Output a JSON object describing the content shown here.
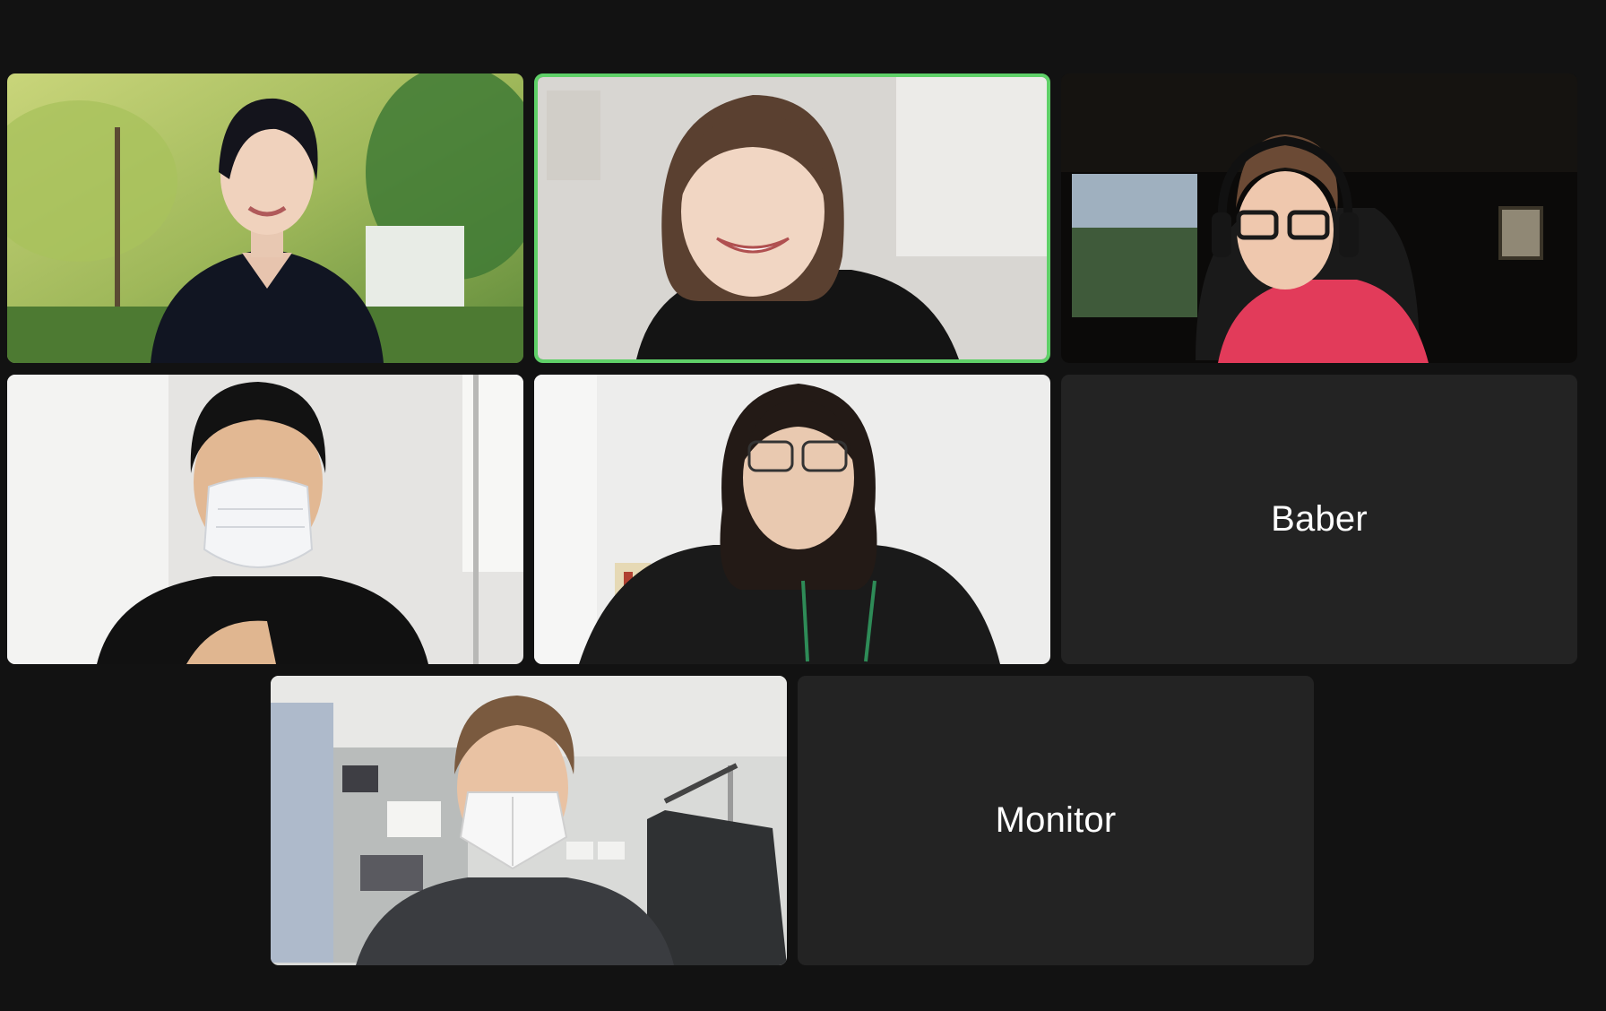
{
  "meeting": {
    "participants": [
      {
        "id": "p1",
        "video": true,
        "speaking": false,
        "scene": "person-outdoors-trees"
      },
      {
        "id": "p2",
        "video": true,
        "speaking": true,
        "scene": "person-indoor-plain-wall"
      },
      {
        "id": "p3",
        "video": true,
        "speaking": false,
        "scene": "person-headset-dark-room"
      },
      {
        "id": "p4",
        "video": true,
        "speaking": false,
        "scene": "person-face-mask-office"
      },
      {
        "id": "p5",
        "video": true,
        "speaking": false,
        "scene": "person-glasses-white-wall"
      },
      {
        "id": "p6",
        "video": false,
        "speaking": false,
        "name": "Baber"
      },
      {
        "id": "p7",
        "video": true,
        "speaking": false,
        "scene": "person-face-mask-lab"
      },
      {
        "id": "p8",
        "video": false,
        "speaking": false,
        "name": "Monitor"
      }
    ]
  },
  "colors": {
    "background": "#121212",
    "tile_background": "#232323",
    "active_speaker_border": "#5fd068",
    "name_text": "#ffffff"
  }
}
